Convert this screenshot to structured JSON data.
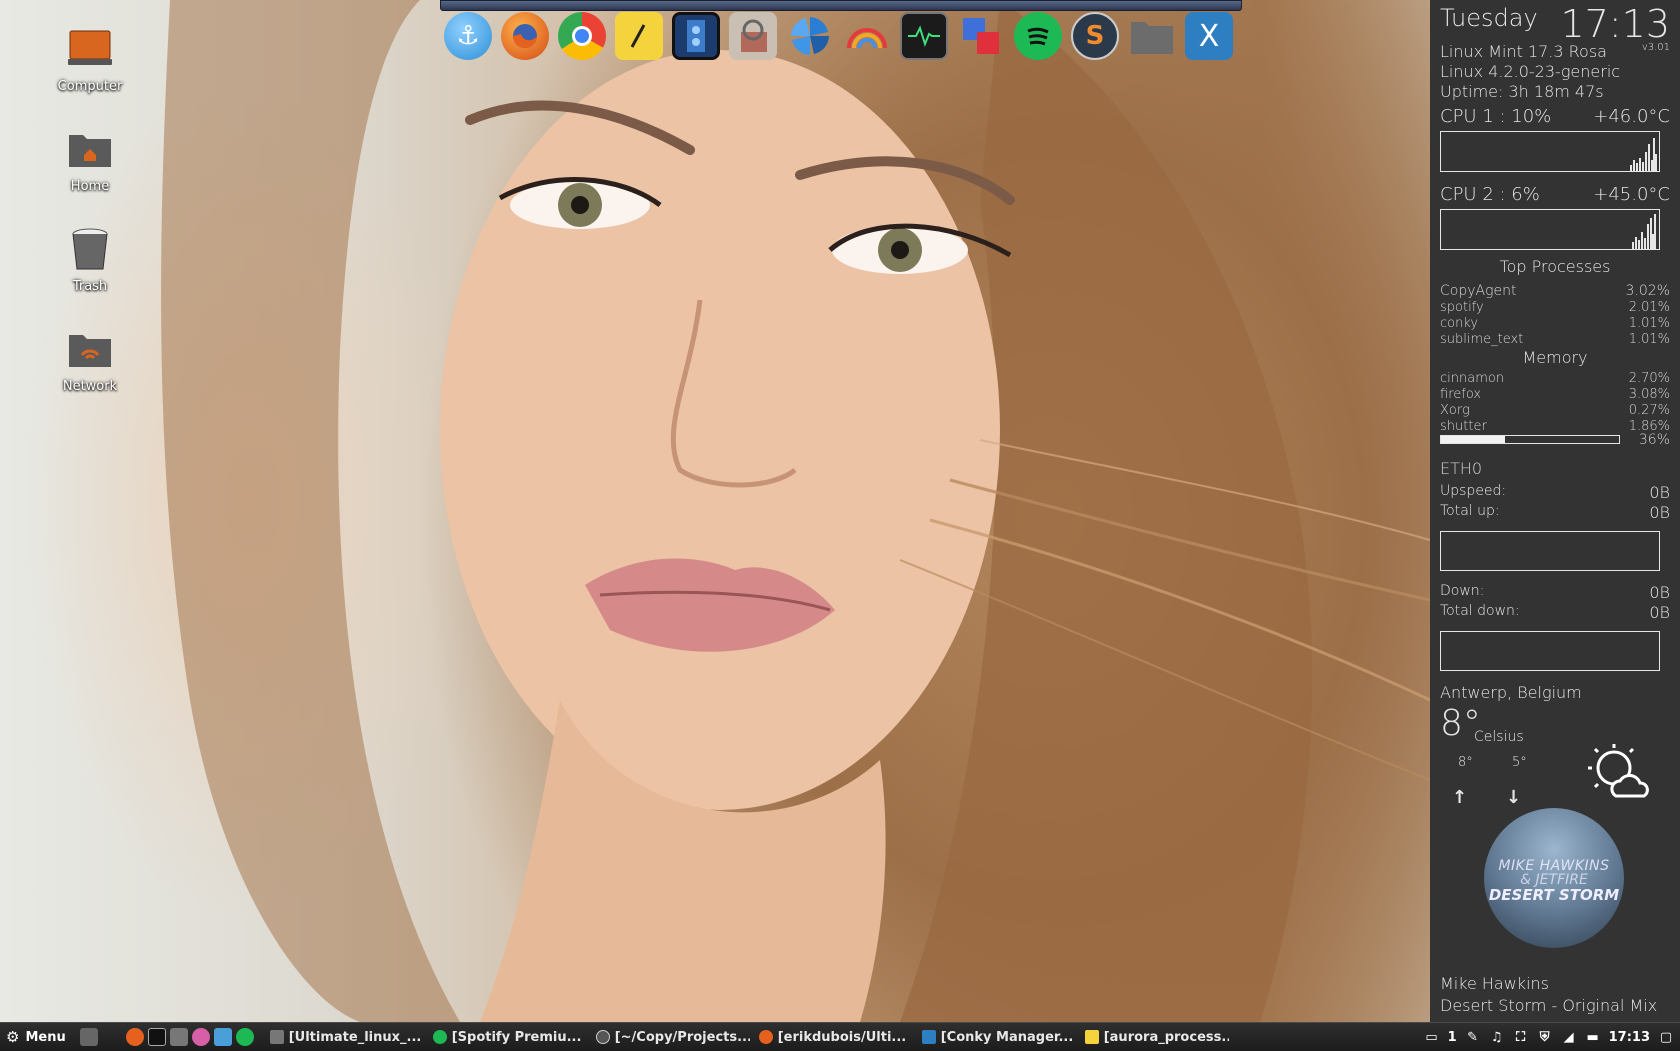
{
  "desktop": {
    "icons": [
      {
        "label": "Computer",
        "icon": "computer-icon"
      },
      {
        "label": "Home",
        "icon": "home-folder-icon"
      },
      {
        "label": "Trash",
        "icon": "trash-icon"
      },
      {
        "label": "Network",
        "icon": "network-folder-icon"
      }
    ]
  },
  "dock": {
    "items": [
      {
        "name": "anchor-app",
        "icon": "anchor-icon",
        "color": "#4aa8e8"
      },
      {
        "name": "firefox",
        "icon": "firefox-icon",
        "color": "#e6601e"
      },
      {
        "name": "chrome",
        "icon": "chrome-icon",
        "color": "#34a853"
      },
      {
        "name": "text-editor",
        "icon": "pencil-note-icon",
        "color": "#f5d33c"
      },
      {
        "name": "video-editor",
        "icon": "film-strip-icon",
        "color": "#1d3c6e"
      },
      {
        "name": "image-viewer",
        "icon": "magnifier-photo-icon",
        "color": "#b0695a"
      },
      {
        "name": "shutter",
        "icon": "pinwheel-icon",
        "color": "#2a7fd4"
      },
      {
        "name": "color-app",
        "icon": "rainbow-icon",
        "color": "#e05a8a"
      },
      {
        "name": "system-monitor",
        "icon": "activity-monitor-icon",
        "color": "#222222"
      },
      {
        "name": "window-switcher",
        "icon": "windows-icon",
        "color": "#3f6fd8"
      },
      {
        "name": "spotify",
        "icon": "spotify-icon",
        "color": "#1db954"
      },
      {
        "name": "sublime-text",
        "icon": "sublime-icon",
        "color": "#2b3a4a"
      },
      {
        "name": "file-manager",
        "icon": "folder-icon",
        "color": "#6c6c6c"
      },
      {
        "name": "conky-manager",
        "icon": "x-icon",
        "color": "#2d7fc1"
      }
    ]
  },
  "conky": {
    "day": "Tuesday",
    "time": "17:13",
    "os": "Linux Mint 17.3 Rosa",
    "version": "v3.01",
    "kernel": "Linux 4.2.0-23-generic",
    "uptime": "Uptime: 3h 18m 47s",
    "cpu1": {
      "label": "CPU 1 : 10%",
      "temp": "+46.0°C"
    },
    "cpu2": {
      "label": "CPU 2 : 6%",
      "temp": "+45.0°C"
    },
    "top_processes_title": "Top Processes",
    "top_processes": [
      {
        "name": "CopyAgent",
        "value": "3.02%"
      },
      {
        "name": "spotify",
        "value": "2.01%"
      },
      {
        "name": "conky",
        "value": "1.01%"
      },
      {
        "name": "sublime_text",
        "value": "1.01%"
      }
    ],
    "memory_title": "Memory",
    "memory_processes": [
      {
        "name": "cinnamon",
        "value": "2.70%"
      },
      {
        "name": "firefox",
        "value": "3.08%"
      },
      {
        "name": "Xorg",
        "value": "0.27%"
      },
      {
        "name": "shutter",
        "value": "1.86%"
      }
    ],
    "memory_percent": "36%",
    "memory_fraction": 0.36,
    "network": {
      "interface": "ETH0",
      "upspeed_label": "Upspeed:",
      "upspeed": "0B",
      "totalup_label": "Total up:",
      "totalup": "0B",
      "down_label": "Down:",
      "down": "0B",
      "totaldown_label": "Total down:",
      "totaldown": "0B"
    },
    "weather": {
      "location": "Antwerp, Belgium",
      "temp": "8°",
      "unit": "Celsius",
      "high": "8°",
      "low": "5°",
      "icon": "sun-cloud-icon"
    },
    "now_playing": {
      "album_art_line1": "MIKE HAWKINS",
      "album_art_line2": "& JETFIRE",
      "album_art_line3": "DESERT STORM",
      "artist": "Mike Hawkins",
      "track": "Desert Storm - Original Mix"
    }
  },
  "taskbar": {
    "menu_label": "Menu",
    "tasks": [
      {
        "label": "[Ultimate_linux_...",
        "icon": "folder-icon",
        "color": "#777777"
      },
      {
        "label": "[Spotify Premiu...",
        "icon": "spotify-icon",
        "color": "#1db954"
      },
      {
        "label": "[~/Copy/Projects...",
        "icon": "terminal-icon",
        "color": "#555555"
      },
      {
        "label": "[erikdubois/Ulti...",
        "icon": "firefox-icon",
        "color": "#e6601e"
      },
      {
        "label": "[Conky Manager...",
        "icon": "x-icon",
        "color": "#2d7fc1"
      },
      {
        "label": "[aurora_process...",
        "icon": "pencil-note-icon",
        "color": "#f5d33c"
      }
    ],
    "workspace": "1",
    "clock": "17:13"
  }
}
